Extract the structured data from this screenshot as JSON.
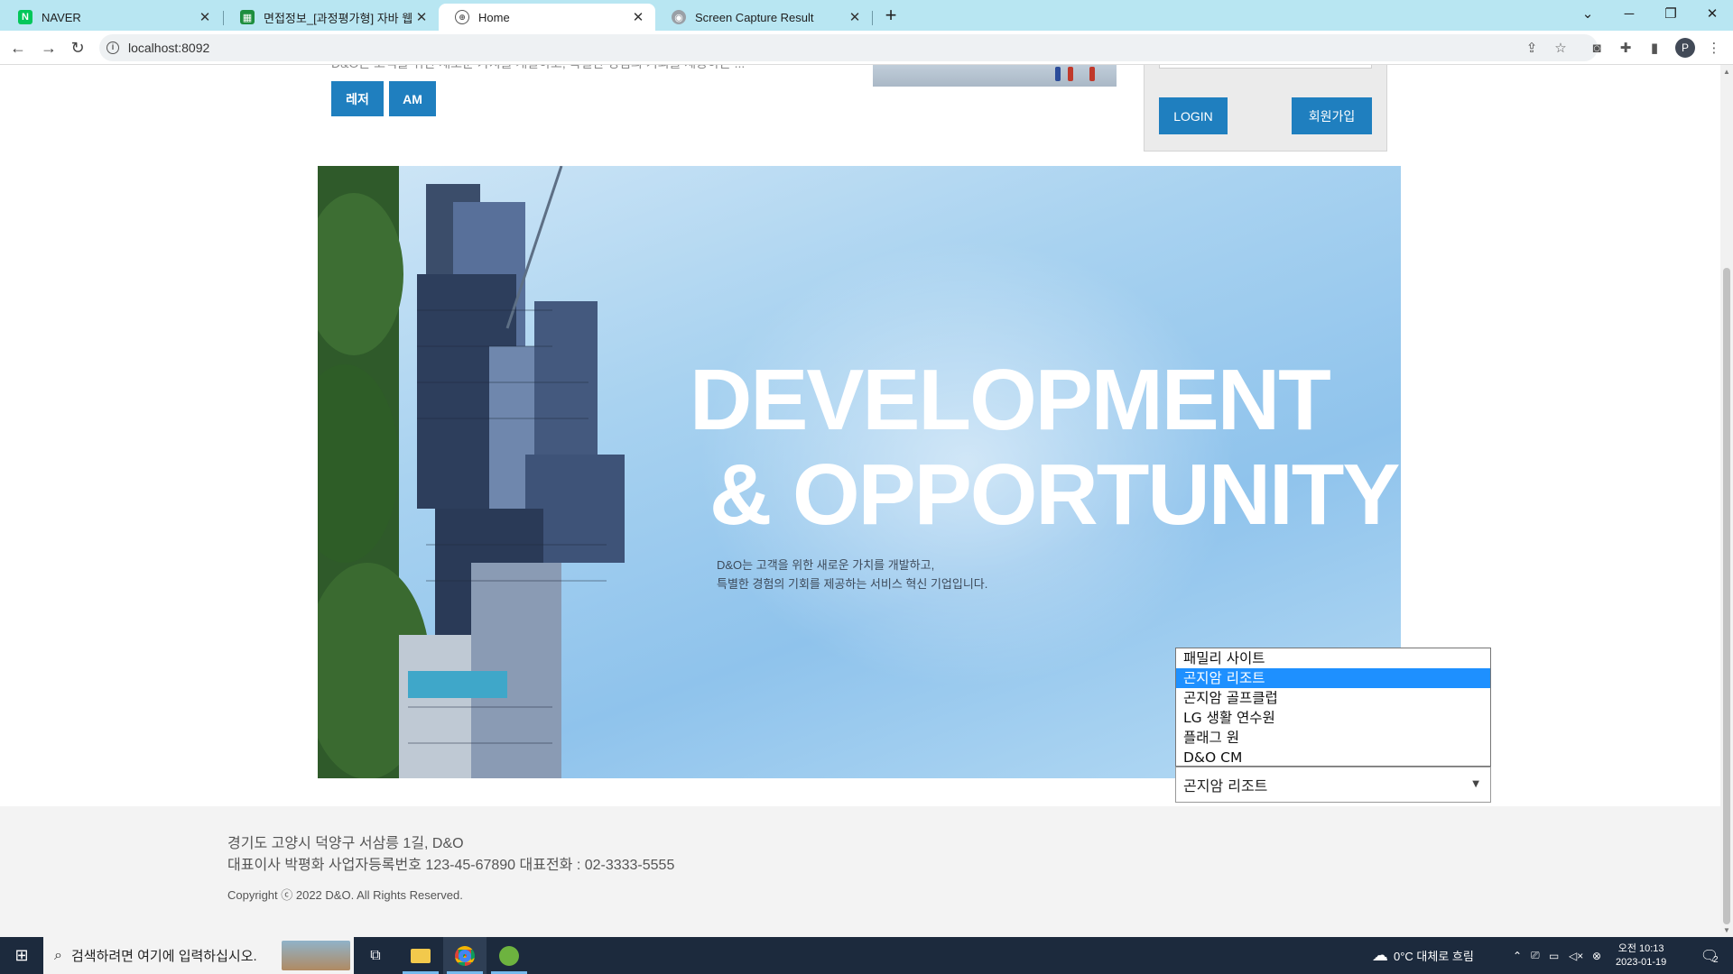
{
  "browser": {
    "tabs": [
      {
        "title": "NAVER",
        "favicon": "naver-icon",
        "active": false
      },
      {
        "title": "면접정보_[과정평가형] 자바 웹기",
        "favicon": "sheets-icon",
        "active": false
      },
      {
        "title": "Home",
        "favicon": "globe-icon",
        "active": true
      },
      {
        "title": "Screen Capture Result",
        "favicon": "camera-icon",
        "active": false
      }
    ],
    "new_tab_glyph": "+",
    "url": "localhost:8092",
    "profile_initial": "P"
  },
  "page": {
    "news_excerpt": "D&O는 고객을 위한 새로운 가치를 개발하고, 특별한 경험의 기회를 제공하는 ...",
    "tags": [
      "레저",
      "AM"
    ],
    "login": {
      "login_label": "LOGIN",
      "signup_label": "회원가입"
    },
    "hero": {
      "title_line1": "DEVELOPMENT",
      "title_line2": "& OPPORTUNITY",
      "desc_line1": "D&O는 고객을 위한 새로운 가치를 개발하고,",
      "desc_line2": "특별한 경험의 기회를 제공하는 서비스 혁신 기업입니다."
    },
    "footer": {
      "address": "경기도 고양시 덕양구 서삼릉 1길, D&O",
      "business": "대표이사 박평화 사업자등록번호 123-45-67890 대표전화 : 02-3333-5555",
      "copyright": "Copyright ⓒ 2022 D&O. All Rights Reserved."
    },
    "family_site": {
      "selected": "곤지암 리조트",
      "options": [
        "패밀리 사이트",
        "곤지암 리조트",
        "곤지암 골프클럽",
        "LG 생활 연수원",
        "플래그 원",
        "D&O CM"
      ],
      "highlighted_index": 1
    }
  },
  "taskbar": {
    "search_placeholder": "검색하려면 여기에 입력하십시오.",
    "weather": "0°C 대체로 흐림",
    "time_ampm": "오전 10:13",
    "date": "2023-01-19",
    "notification_count": "2"
  },
  "colors": {
    "accent_blue": "#1f7fbf",
    "tabstrip": "#b8e6f2",
    "taskbar": "#1c2a3d",
    "dropdown_highlight": "#1e90ff"
  }
}
